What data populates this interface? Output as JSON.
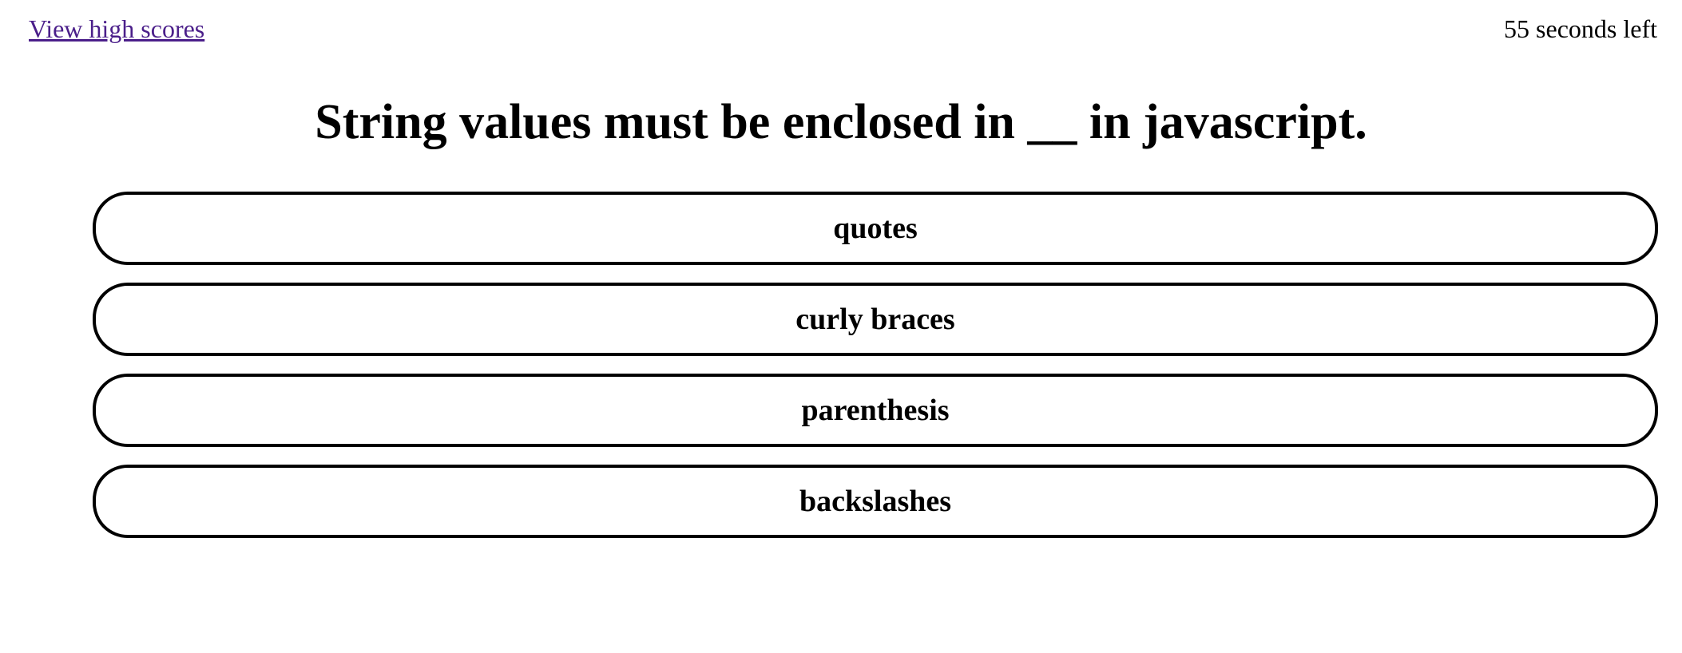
{
  "header": {
    "high_scores_link": "View high scores",
    "timer_text": "55 seconds left"
  },
  "quiz": {
    "question": "String values must be enclosed in __ in javascript.",
    "answers": [
      {
        "label": "quotes"
      },
      {
        "label": "curly braces"
      },
      {
        "label": "parenthesis"
      },
      {
        "label": "backslashes"
      }
    ]
  },
  "colors": {
    "link": "#4b1f8a",
    "border": "#000000",
    "background": "#ffffff"
  }
}
